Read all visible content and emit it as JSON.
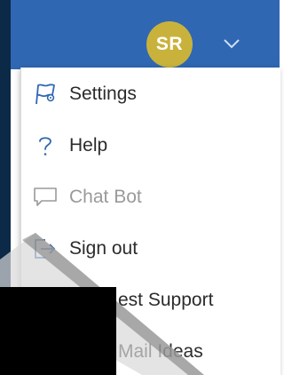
{
  "header": {
    "avatar_initials": "SR",
    "avatar_color": "#c9b23c",
    "bar_color": "#2f67b3",
    "menu_toggle_icon": "chevron-down-icon"
  },
  "menu": {
    "items": [
      {
        "label": "Settings",
        "icon": "settings-flag-icon",
        "enabled": true
      },
      {
        "label": "Help",
        "icon": "question-icon",
        "enabled": true
      },
      {
        "label": "Chat Bot",
        "icon": "chat-bubble-icon",
        "enabled": false
      },
      {
        "label": "Sign out",
        "icon": "sign-out-icon",
        "enabled": true
      },
      {
        "label": "est Support",
        "icon": "",
        "enabled": true
      },
      {
        "label": "Mail Ideas",
        "icon": "",
        "enabled": true
      }
    ]
  }
}
